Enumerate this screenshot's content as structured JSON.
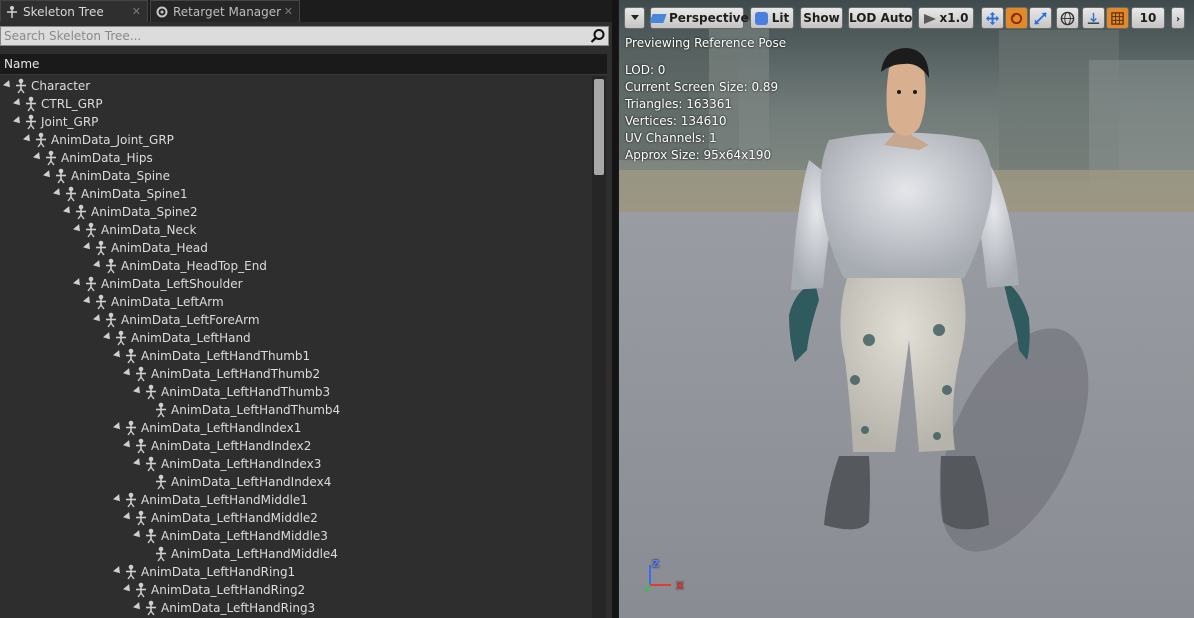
{
  "tabs": [
    {
      "label": "Skeleton Tree",
      "icon": "skeleton-icon"
    },
    {
      "label": "Retarget Manager",
      "icon": "retarget-icon"
    }
  ],
  "search": {
    "placeholder": "Search Skeleton Tree..."
  },
  "tree_header": {
    "name_label": "Name"
  },
  "tree_rows": [
    {
      "label": "Character",
      "depth": 0
    },
    {
      "label": "CTRL_GRP",
      "depth": 1
    },
    {
      "label": "Joint_GRP",
      "depth": 1
    },
    {
      "label": "AnimData_Joint_GRP",
      "depth": 2
    },
    {
      "label": "AnimData_Hips",
      "depth": 3
    },
    {
      "label": "AnimData_Spine",
      "depth": 4
    },
    {
      "label": "AnimData_Spine1",
      "depth": 5
    },
    {
      "label": "AnimData_Spine2",
      "depth": 6
    },
    {
      "label": "AnimData_Neck",
      "depth": 7
    },
    {
      "label": "AnimData_Head",
      "depth": 8
    },
    {
      "label": "AnimData_HeadTop_End",
      "depth": 9
    },
    {
      "label": "AnimData_LeftShoulder",
      "depth": 7
    },
    {
      "label": "AnimData_LeftArm",
      "depth": 8
    },
    {
      "label": "AnimData_LeftForeArm",
      "depth": 9
    },
    {
      "label": "AnimData_LeftHand",
      "depth": 10
    },
    {
      "label": "AnimData_LeftHandThumb1",
      "depth": 11
    },
    {
      "label": "AnimData_LeftHandThumb2",
      "depth": 12
    },
    {
      "label": "AnimData_LeftHandThumb3",
      "depth": 13
    },
    {
      "label": "AnimData_LeftHandThumb4",
      "depth": 14
    },
    {
      "label": "AnimData_LeftHandIndex1",
      "depth": 11
    },
    {
      "label": "AnimData_LeftHandIndex2",
      "depth": 12
    },
    {
      "label": "AnimData_LeftHandIndex3",
      "depth": 13
    },
    {
      "label": "AnimData_LeftHandIndex4",
      "depth": 14
    },
    {
      "label": "AnimData_LeftHandMiddle1",
      "depth": 11
    },
    {
      "label": "AnimData_LeftHandMiddle2",
      "depth": 12
    },
    {
      "label": "AnimData_LeftHandMiddle3",
      "depth": 13
    },
    {
      "label": "AnimData_LeftHandMiddle4",
      "depth": 14
    },
    {
      "label": "AnimData_LeftHandRing1",
      "depth": 11
    },
    {
      "label": "AnimData_LeftHandRing2",
      "depth": 12
    },
    {
      "label": "AnimData_LeftHandRing3",
      "depth": 13
    }
  ],
  "toolbar": {
    "perspective_label": "Perspective",
    "lit_label": "Lit",
    "show_label": "Show",
    "lod_label": "LOD Auto",
    "speed_label": "x1.0",
    "grid_size_label": "10"
  },
  "viewport": {
    "status_text": "Previewing Reference Pose",
    "stats": [
      "LOD: 0",
      "Current Screen Size: 0.89",
      "Triangles: 163361",
      "Vertices: 134610",
      "UV Channels: 1",
      "Approx Size: 95x64x190"
    ],
    "axis_z": "Z",
    "axis_x": "X"
  },
  "colors": {
    "accent_orange": "#e08a2a",
    "panel_bg": "#2e2e2e",
    "tree_text": "#dcdcdc"
  }
}
